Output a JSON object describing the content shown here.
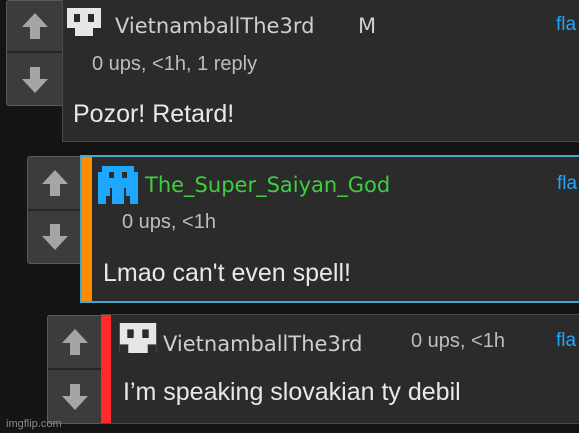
{
  "colors": {
    "link": "#1ea7ff",
    "highlight_border": "#3fa9d4",
    "orange_bar": "#ff8c00",
    "red_bar": "#ff2b2b",
    "username_green": "#3ecf3e"
  },
  "comments": [
    {
      "username": "VietnamballThe3rd",
      "badge": "M",
      "meta": "0 ups, <1h, 1 reply",
      "text": "Pozor! Retard!",
      "flag": "fla",
      "avatar_icon": "pixel-face-icon"
    },
    {
      "username": "The_Super_Saiyan_God",
      "meta": "0 ups, <1h",
      "text": "Lmao can't even spell!",
      "flag": "fla",
      "avatar_icon": "blue-pixel-avatar-icon"
    },
    {
      "username": "VietnamballThe3rd",
      "meta": "0 ups, <1h",
      "text": "I’m speaking slovakian ty debil",
      "flag": "fla",
      "avatar_icon": "pixel-face-icon"
    }
  ],
  "watermark": "imgflip.com"
}
